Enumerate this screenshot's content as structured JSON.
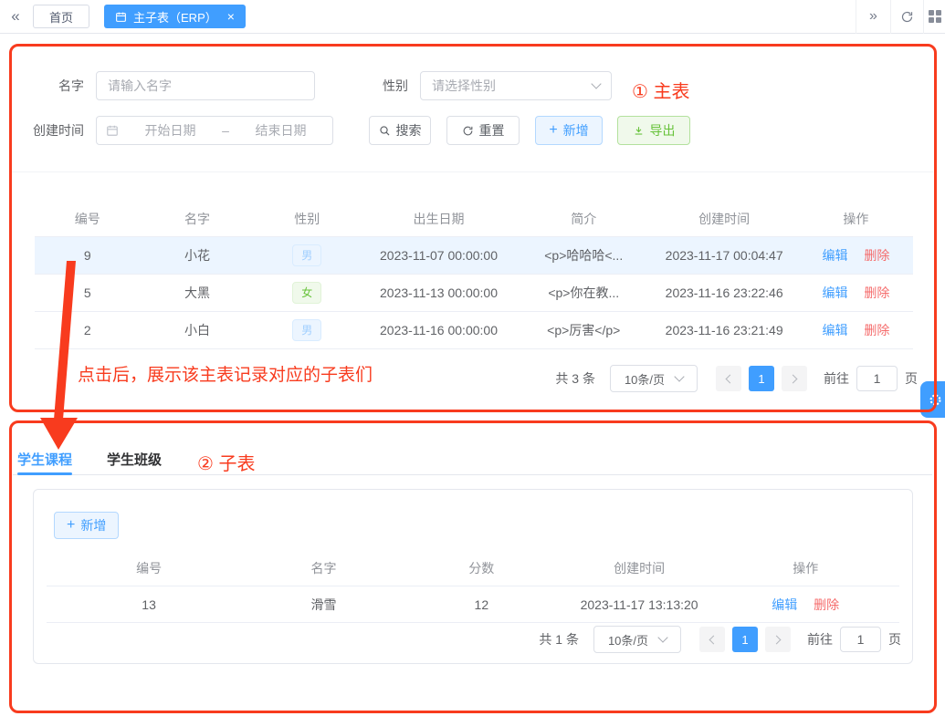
{
  "colors": {
    "accent": "#409eff",
    "annotation_red": "#f83b1e",
    "success_green": "#67c23a",
    "danger_red": "#f56c6c",
    "highlight_row": "#ecf5ff"
  },
  "icons": {
    "collapse": "«",
    "expand": "»",
    "close": "×",
    "plus": "+"
  },
  "tabbar": {
    "home_tab": "首页",
    "active_tab": "主子表（ERP）"
  },
  "search_form": {
    "name_label": "名字",
    "name_placeholder": "请输入名字",
    "gender_label": "性别",
    "gender_placeholder": "请选择性别",
    "created_label": "创建时间",
    "date_start_placeholder": "开始日期",
    "date_separator": "–",
    "date_end_placeholder": "结束日期",
    "search_button": "搜索",
    "reset_button": "重置",
    "add_button": "新增",
    "export_button": "导出"
  },
  "annotations": {
    "main_label": "① 主表",
    "child_label": "② 子表",
    "click_hint": "点击后，展示该主表记录对应的子表们"
  },
  "main_table": {
    "headers": [
      "编号",
      "名字",
      "性别",
      "出生日期",
      "简介",
      "创建时间",
      "操作"
    ],
    "actions": {
      "edit": "编辑",
      "delete": "删除"
    },
    "rows": [
      {
        "id": "9",
        "name": "小花",
        "gender": "男",
        "birth": "2023-11-07 00:00:00",
        "intro": "<p>哈哈哈<...",
        "created": "2023-11-17 00:04:47"
      },
      {
        "id": "5",
        "name": "大黑",
        "gender": "女",
        "birth": "2023-11-13 00:00:00",
        "intro": "<p>你在教...",
        "created": "2023-11-16 23:22:46"
      },
      {
        "id": "2",
        "name": "小白",
        "gender": "男",
        "birth": "2023-11-16 00:00:00",
        "intro": "<p>厉害</p>",
        "created": "2023-11-16 23:21:49"
      }
    ]
  },
  "main_pagination": {
    "total": "共 3 条",
    "page_size": "10条/页",
    "current_page": "1",
    "goto_label": "前往",
    "goto_value": "1",
    "page_unit": "页"
  },
  "child_section": {
    "tabs": [
      {
        "label": "学生课程"
      },
      {
        "label": "学生班级"
      }
    ],
    "add_button": "新增",
    "table": {
      "headers": [
        "编号",
        "名字",
        "分数",
        "创建时间",
        "操作"
      ],
      "rows": [
        {
          "id": "13",
          "name": "滑雪",
          "score": "12",
          "created": "2023-11-17 13:13:20"
        }
      ]
    },
    "pagination": {
      "total": "共 1 条",
      "page_size": "10条/页",
      "current_page": "1",
      "goto_label": "前往",
      "goto_value": "1",
      "page_unit": "页"
    }
  }
}
